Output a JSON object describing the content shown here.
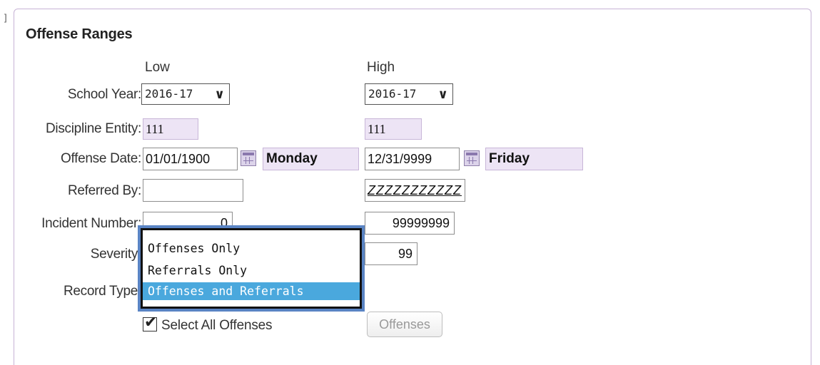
{
  "title": "Offense Ranges",
  "columns": {
    "low": "Low",
    "high": "High"
  },
  "fields": {
    "school_year": {
      "label": "School Year:",
      "low": "2016-17",
      "high": "2016-17"
    },
    "discipline_entity": {
      "label": "Discipline Entity:",
      "low": "111",
      "high": "111"
    },
    "offense_date": {
      "label": "Offense Date:",
      "low": "01/01/1900",
      "low_day": "Monday",
      "high": "12/31/9999",
      "high_day": "Friday"
    },
    "referred_by": {
      "label": "Referred By:",
      "low": "",
      "high": "ZZZZZZZZZZZ"
    },
    "incident_number": {
      "label": "Incident Number:",
      "low": "0",
      "high": "99999999"
    },
    "severity": {
      "label": "Severity:",
      "high": "99"
    },
    "record_type": {
      "label": "Record Type:",
      "options": [
        "Offenses Only",
        "Referrals Only",
        "Offenses and Referrals"
      ],
      "selected": "Offenses and Referrals"
    }
  },
  "select_all": {
    "label": "Select All Offenses",
    "checked": true
  },
  "offenses_button": "Offenses",
  "icons": {
    "dropdown": "chevron-down-icon",
    "calendar": "calendar-icon",
    "check": "checkmark-icon"
  },
  "colors": {
    "readonly_bg": "#ede4f5",
    "panel_border": "#c7b3d6",
    "dropdown_focus": "#5a84c4",
    "selected_option": "#4aa8dd"
  }
}
